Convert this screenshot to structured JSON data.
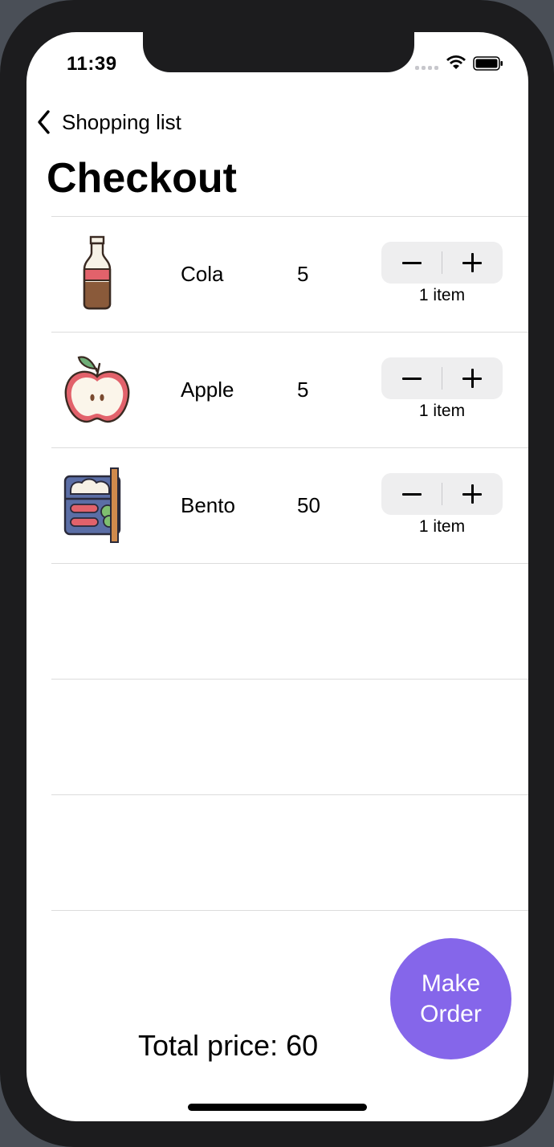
{
  "status_bar": {
    "time": "11:39"
  },
  "nav": {
    "back_label": "Shopping list",
    "title": "Checkout"
  },
  "items": [
    {
      "name": "Cola",
      "price": "5",
      "count": "1 item",
      "icon": "cola-bottle-icon"
    },
    {
      "name": "Apple",
      "price": "5",
      "count": "1 item",
      "icon": "apple-icon"
    },
    {
      "name": "Bento",
      "price": "50",
      "count": "1 item",
      "icon": "bento-box-icon"
    }
  ],
  "footer": {
    "total": "Total price: 60",
    "order_line1": "Make",
    "order_line2": "Order"
  },
  "colors": {
    "accent": "#8566ea",
    "stepper_bg": "#eeeeef",
    "divider": "#dcdcdc"
  }
}
